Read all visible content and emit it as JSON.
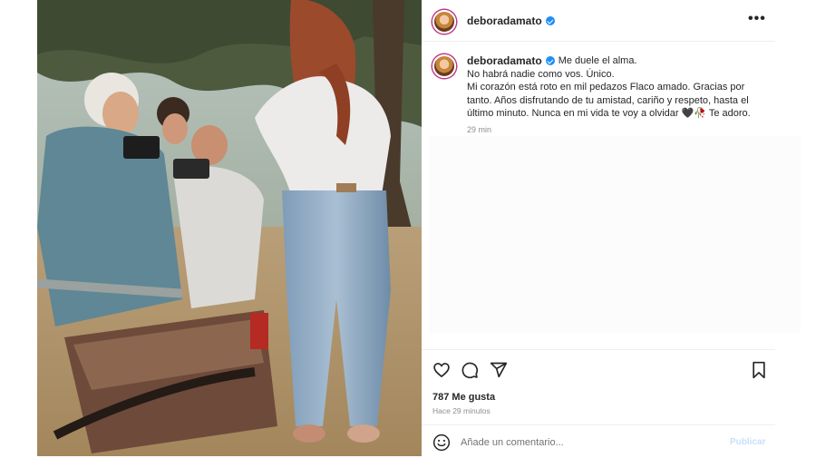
{
  "post": {
    "username": "deboradamato",
    "verified_color": "#1f8ff5",
    "more_label": "•••",
    "caption": {
      "line1": "Me duele el alma.",
      "line2": "No habrá nadie como vos. Único.",
      "line3": "Mi corazón está roto en mil pedazos Flaco amado. Gracias por tanto. Años disfrutando de tu amistad, cariño y respeto, hasta el último minuto. Nunca en mi vida te voy a olvidar 🖤🥀 Te adoro."
    },
    "time": "29 min"
  },
  "actions": {
    "icons": [
      "heart-icon",
      "comment-icon",
      "share-icon",
      "bookmark-icon"
    ],
    "likes": "787 Me gusta",
    "ago": "Hace 29 minutos"
  },
  "comment": {
    "placeholder": "Añade un comentario...",
    "publish_label": "Publicar",
    "publish_color": "#c7dffa",
    "emoji_icon": "smile-icon"
  }
}
